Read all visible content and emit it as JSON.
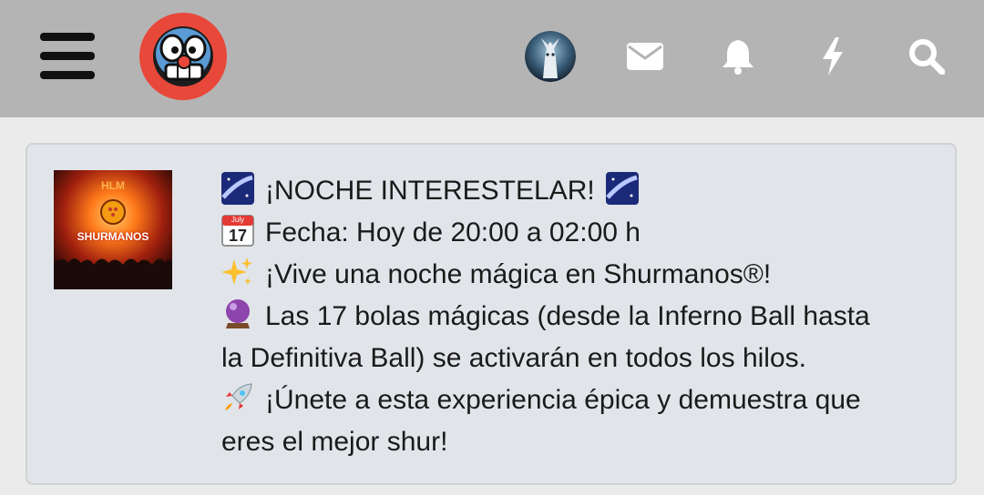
{
  "header": {
    "menu_icon": "hamburger-menu-icon",
    "logo_icon": "site-logo-face-icon",
    "avatar_icon": "user-avatar-icon",
    "icons": [
      "envelope-icon",
      "bell-icon",
      "lightning-icon",
      "search-icon"
    ],
    "bar_color": "#b4b4b4",
    "logo_color": "#e8483a"
  },
  "notice": {
    "thumbnail": {
      "top_text": "HLM",
      "brand_text": "SHURMANOS"
    },
    "lines": [
      {
        "emoji": "milky-way-icon",
        "text": "¡NOCHE INTERESTELAR!",
        "trailing_emoji": "milky-way-icon"
      },
      {
        "emoji": "calendar-icon",
        "emoji_month": "July",
        "emoji_day": "17",
        "text": "Fecha: Hoy de 20:00 a 02:00 h"
      },
      {
        "emoji": "sparkles-icon",
        "text": "¡Vive una noche mágica en Shurmanos®!"
      },
      {
        "emoji": "crystal-ball-icon",
        "text": "Las 17 bolas mágicas (desde la Inferno Ball hasta"
      },
      {
        "text": "la Definitiva Ball) se activarán en todos los hilos."
      },
      {
        "emoji": "rocket-icon",
        "text": "¡Únete a esta experiencia épica y demuestra que"
      },
      {
        "text": "eres el mejor shur!"
      }
    ]
  }
}
